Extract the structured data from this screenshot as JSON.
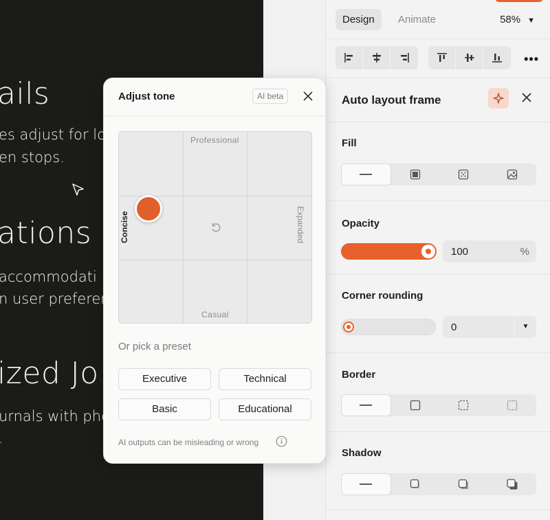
{
  "canvas": {
    "heading_1": "ails",
    "body_1a": "es adjust for lo",
    "body_1b": "en stops.",
    "heading_2": "ations",
    "body_2a": "accommodati",
    "body_2b": "n user preferen",
    "heading_3": "ized Jo",
    "body_3a": "urnals with pho",
    "body_3b": "."
  },
  "props": {
    "tabs": {
      "design": "Design",
      "animate": "Animate"
    },
    "zoom": "58%",
    "frame_title": "Auto layout frame",
    "fill_label": "Fill",
    "opacity_label": "Opacity",
    "opacity_value": "100",
    "opacity_unit": "%",
    "opacity_fraction": 1.0,
    "corner_label": "Corner rounding",
    "corner_value": "0",
    "border_label": "Border",
    "shadow_label": "Shadow",
    "accent": "#e8612c"
  },
  "tone": {
    "title": "Adjust tone",
    "badge": "AI beta",
    "axis_top": "Professional",
    "axis_bottom": "Casual",
    "axis_left": "Concise",
    "axis_right": "Expanded",
    "preset_label": "Or pick a preset",
    "presets": [
      "Executive",
      "Technical",
      "Basic",
      "Educational"
    ],
    "footer": "AI outputs can be misleading or wrong"
  }
}
